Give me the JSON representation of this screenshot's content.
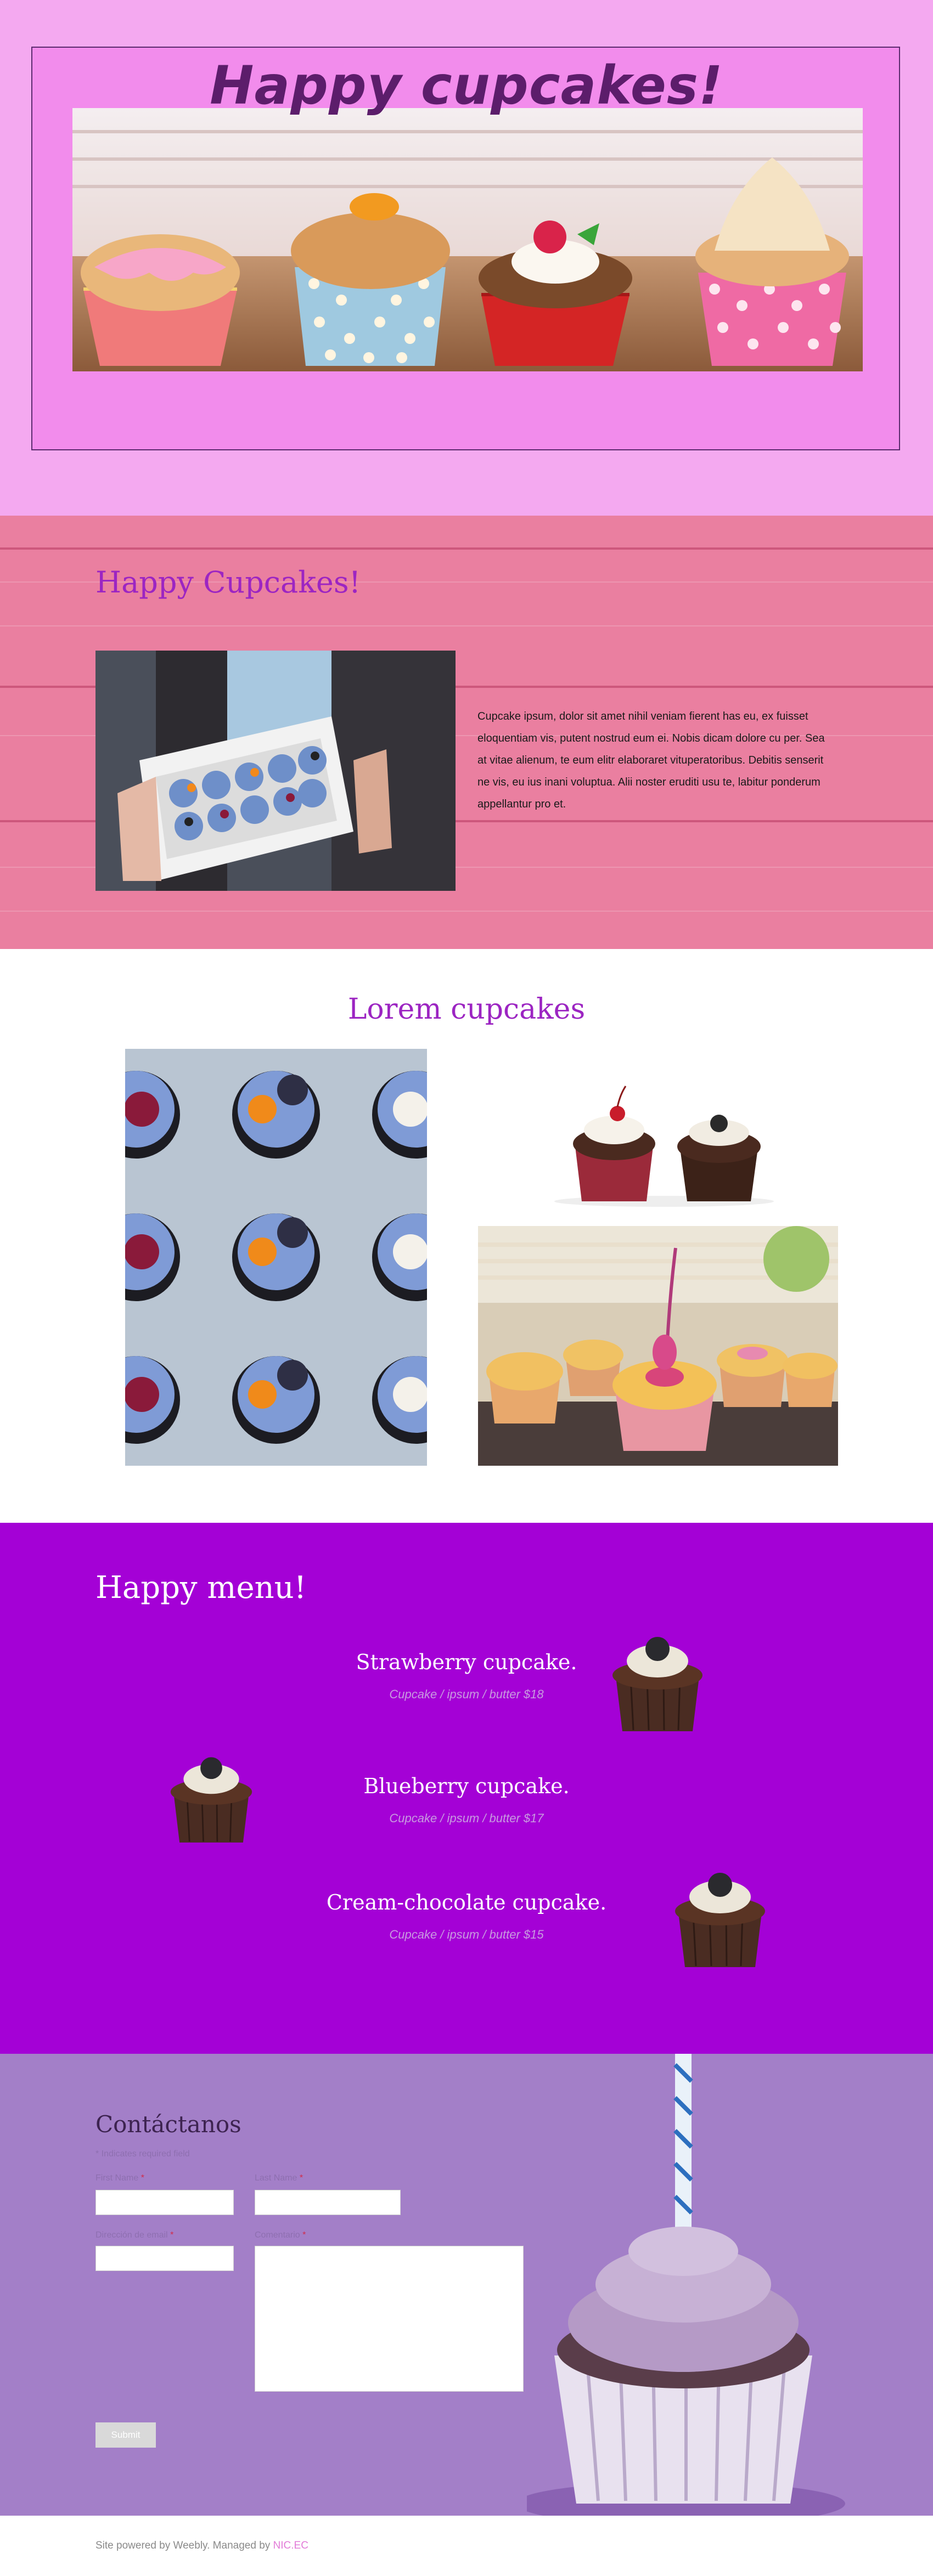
{
  "hero": {
    "title": "Happy cupcakes!"
  },
  "about": {
    "title": "Happy Cupcakes!",
    "paragraph": "Cupcake ipsum, dolor sit amet nihil veniam fierent has eu, ex fuisset eloquentiam vis, putent nostrud eum ei. Nobis dicam dolore cu per. Sea at vitae alienum, te eum elitr elaboraret vituperatoribus. Debitis senserit ne vis, eu ius inani voluptua. Alii noster eruditi usu te, labitur ponderum appellantur pro et."
  },
  "gallery": {
    "title": "Lorem cupcakes"
  },
  "menu": {
    "title": "Happy menu!",
    "items": [
      {
        "name": "Strawberry cupcake.",
        "desc": "Cupcake / ipsum / butter  $18"
      },
      {
        "name": "Blueberry cupcake.",
        "desc": "Cupcake / ipsum / butter  $17"
      },
      {
        "name": "Cream-chocolate cupcake.",
        "desc": "Cupcake / ipsum / butter  $15"
      }
    ]
  },
  "contact": {
    "title": "Contáctanos",
    "required_note": "* Indicates required field",
    "first_name_label": "First Name",
    "last_name_label": "Last Name",
    "email_label": "Dirección de email",
    "comment_label": "Comentario",
    "required_mark": "*",
    "submit_label": "Submit"
  },
  "footer": {
    "text": "Site powered by Weebly. Managed by ",
    "link": "NIC.EC"
  },
  "colors": {
    "hero_bg": "#f4a9f0",
    "about_bg": "#ea7fa0",
    "accent_purple": "#9c25c2",
    "menu_bg": "#a401d6",
    "contact_bg": "#a37fc8"
  }
}
